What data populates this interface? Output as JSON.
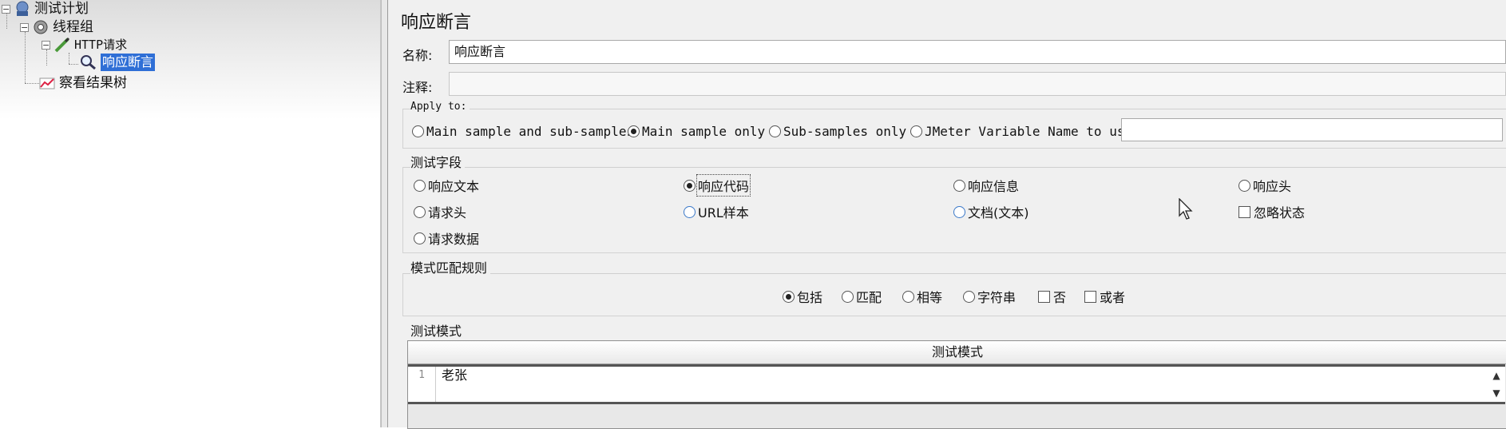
{
  "tree": {
    "root_label": "测试计划",
    "thread_group_label": "线程组",
    "http_request_label": "HTTP请求",
    "assertion_label": "响应断言",
    "results_tree_label": "察看结果树"
  },
  "panel": {
    "title": "响应断言",
    "name_label": "名称:",
    "name_value": "响应断言",
    "comment_label": "注释:",
    "comment_value": ""
  },
  "apply_to": {
    "title": "Apply to:",
    "options": [
      "Main sample and sub-samples",
      "Main sample only",
      "Sub-samples only",
      "JMeter Variable Name to use"
    ],
    "selected": "Main sample only",
    "variable_value": ""
  },
  "test_field": {
    "title": "测试字段",
    "options": [
      "响应文本",
      "响应代码",
      "响应信息",
      "响应头",
      "请求头",
      "URL样本",
      "文档(文本)",
      "忽略状态",
      "请求数据"
    ],
    "selected": "响应代码",
    "ignore_status_checked": false
  },
  "pattern_rules": {
    "title": "模式匹配规则",
    "options": [
      "包括",
      "匹配",
      "相等",
      "字符串",
      "否",
      "或者"
    ],
    "selected": "包括",
    "not_checked": false,
    "or_checked": false
  },
  "test_patterns": {
    "title": "测试模式",
    "column_header": "测试模式",
    "rows": [
      {
        "line": "1",
        "text": "老张"
      }
    ]
  },
  "colors": {
    "selection": "#2f6fd6",
    "panel_bg": "#f0f0f0"
  },
  "icons": [
    "plan-icon",
    "thread-group-gear-icon",
    "http-request-pen-icon",
    "assertion-magnifier-icon",
    "results-tree-graph-icon",
    "mouse-cursor-icon",
    "scroll-up-icon",
    "scroll-down-icon"
  ]
}
